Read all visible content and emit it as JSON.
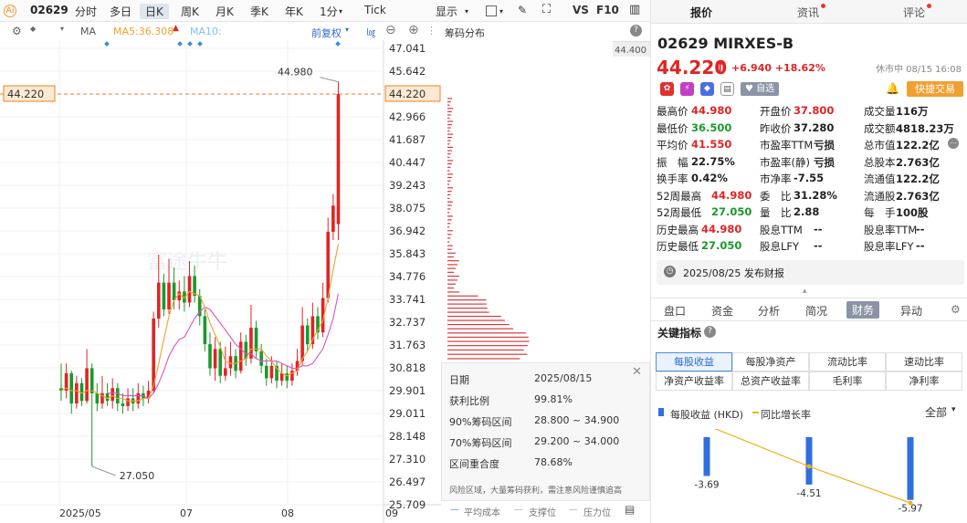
{
  "toolbar": {
    "ai_label": "Ai",
    "code": "02629",
    "periods": [
      "分时",
      "多日",
      "日K",
      "周K",
      "月K",
      "季K",
      "年K",
      "1分"
    ],
    "active_period": "日K",
    "tick": "Tick",
    "display": "显示",
    "vs": "VS",
    "f10": "F10"
  },
  "indicator_bar": {
    "ma": "MA",
    "ma5": "MA5:36.308",
    "ma10": "MA10:",
    "adjust": "前复权",
    "chip_title": "筹码分布"
  },
  "chart_data": {
    "type": "candlestick",
    "y_ticks": [
      "47.041",
      "45.642",
      "44.220",
      "42.966",
      "41.687",
      "40.447",
      "39.243",
      "38.075",
      "36.942",
      "35.843",
      "34.776",
      "33.741",
      "32.737",
      "31.763",
      "30.818",
      "29.901",
      "29.011",
      "28.148",
      "27.310",
      "26.497",
      "25.709"
    ],
    "current_price_label": "44.220",
    "current_price": 44.22,
    "high_annotation": "44.980",
    "low_annotation": "27.050",
    "x_labels": [
      "2025/05",
      "07",
      "08",
      "09"
    ],
    "chip_top_label": "44.400",
    "candles": [
      [
        30.0,
        29.9,
        31.0,
        29.5
      ],
      [
        29.9,
        30.6,
        31.0,
        29.6
      ],
      [
        30.6,
        29.4,
        30.7,
        29.0
      ],
      [
        29.4,
        30.2,
        30.5,
        29.2
      ],
      [
        30.2,
        29.5,
        30.4,
        29.3
      ],
      [
        29.5,
        30.8,
        31.6,
        29.4
      ],
      [
        30.8,
        29.8,
        31.0,
        27.05
      ],
      [
        29.8,
        29.4,
        30.2,
        29.1
      ],
      [
        29.4,
        29.8,
        30.5,
        29.2
      ],
      [
        29.8,
        29.5,
        30.2,
        29.3
      ],
      [
        29.5,
        30.0,
        30.4,
        29.2
      ],
      [
        30.0,
        29.4,
        30.2,
        29.1
      ],
      [
        29.4,
        29.3,
        29.8,
        29.0
      ],
      [
        29.3,
        29.6,
        30.0,
        29.1
      ],
      [
        29.6,
        29.4,
        30.0,
        29.1
      ],
      [
        29.4,
        29.8,
        30.2,
        29.2
      ],
      [
        29.8,
        29.6,
        30.1,
        29.3
      ],
      [
        29.6,
        29.9,
        30.3,
        29.4
      ],
      [
        29.9,
        32.9,
        33.2,
        29.8
      ],
      [
        32.9,
        34.5,
        35.8,
        32.5
      ],
      [
        34.5,
        33.3,
        34.9,
        33.0
      ],
      [
        33.3,
        34.5,
        35.6,
        33.1
      ],
      [
        34.5,
        33.7,
        35.2,
        33.3
      ],
      [
        33.7,
        34.1,
        34.6,
        33.3
      ],
      [
        34.1,
        33.6,
        34.8,
        33.2
      ],
      [
        33.6,
        34.8,
        35.5,
        33.4
      ],
      [
        34.8,
        33.9,
        35.3,
        33.6
      ],
      [
        33.9,
        33.0,
        34.2,
        32.6
      ],
      [
        33.0,
        31.8,
        33.3,
        31.5
      ],
      [
        31.8,
        30.8,
        32.3,
        30.5
      ],
      [
        30.8,
        31.6,
        32.1,
        30.3
      ],
      [
        31.6,
        30.5,
        31.9,
        30.2
      ],
      [
        30.5,
        30.8,
        31.7,
        30.3
      ],
      [
        30.8,
        31.3,
        31.9,
        30.5
      ],
      [
        31.3,
        30.7,
        31.6,
        30.4
      ],
      [
        30.7,
        31.9,
        32.3,
        30.6
      ],
      [
        31.9,
        31.2,
        32.2,
        30.9
      ],
      [
        31.2,
        32.5,
        33.5,
        31.0
      ],
      [
        32.5,
        31.5,
        32.8,
        31.2
      ],
      [
        31.5,
        30.9,
        31.8,
        30.6
      ],
      [
        30.9,
        30.4,
        31.2,
        30.1
      ],
      [
        30.4,
        30.9,
        31.3,
        30.2
      ],
      [
        30.9,
        30.3,
        31.1,
        30.0
      ],
      [
        30.3,
        30.6,
        31.0,
        30.1
      ],
      [
        30.6,
        30.3,
        30.9,
        30.0
      ],
      [
        30.3,
        30.7,
        31.0,
        30.1
      ],
      [
        30.7,
        31.1,
        31.6,
        30.5
      ],
      [
        31.1,
        32.6,
        33.4,
        30.9
      ],
      [
        32.6,
        31.8,
        32.9,
        31.5
      ],
      [
        31.8,
        33.0,
        33.6,
        31.6
      ],
      [
        33.0,
        32.3,
        33.4,
        32.0
      ],
      [
        32.3,
        33.8,
        34.5,
        32.1
      ],
      [
        33.8,
        36.9,
        37.6,
        33.6
      ],
      [
        36.9,
        38.2,
        38.8,
        36.5
      ],
      [
        37.28,
        44.22,
        44.98,
        36.5
      ]
    ],
    "ma5": [
      29.9,
      30.0,
      29.9,
      29.9,
      29.8,
      29.9,
      29.9,
      29.8,
      29.7,
      29.6,
      29.7,
      29.6,
      29.6,
      29.5,
      29.5,
      29.5,
      29.6,
      29.6,
      30.1,
      31.0,
      32.0,
      33.0,
      33.7,
      34.0,
      33.8,
      34.1,
      34.0,
      33.9,
      33.4,
      32.7,
      32.2,
      31.7,
      31.1,
      31.0,
      31.0,
      31.1,
      31.2,
      31.6,
      31.6,
      31.6,
      31.3,
      31.1,
      30.8,
      30.6,
      30.5,
      30.6,
      30.7,
      31.2,
      31.5,
      32.0,
      32.4,
      32.8,
      33.8,
      35.1,
      36.31
    ],
    "ma10": [
      null,
      null,
      null,
      null,
      null,
      null,
      null,
      null,
      null,
      29.8,
      29.8,
      29.8,
      29.7,
      29.7,
      29.7,
      29.7,
      29.7,
      29.6,
      29.8,
      30.2,
      30.7,
      31.3,
      31.7,
      32.0,
      32.1,
      32.5,
      32.9,
      33.2,
      33.4,
      33.3,
      33.0,
      32.7,
      32.4,
      32.1,
      31.8,
      31.6,
      31.4,
      31.4,
      31.2,
      31.1,
      31.1,
      31.1,
      31.1,
      31.0,
      30.9,
      30.8,
      30.8,
      30.9,
      30.9,
      31.0,
      31.3,
      31.6,
      32.2,
      32.9,
      34.0
    ]
  },
  "chip_info": {
    "date_label": "日期",
    "date_value": "2025/08/15",
    "profit_label": "获利比例",
    "profit_value": "99.81%",
    "r90_label": "90%筹码区间",
    "r90_value": "28.800 ~ 34.900",
    "r70_label": "70%筹码区间",
    "r70_value": "29.200 ~ 34.000",
    "overlap_label": "区间重合度",
    "overlap_value": "78.68%",
    "warning": "风险区域，大量筹码获利，需注意风险谨慎追高",
    "legend_avg": "平均成本",
    "legend_support": "支撑位",
    "legend_pressure": "压力位"
  },
  "right_tabs": [
    "报价",
    "资讯",
    "评论"
  ],
  "stock": {
    "code_name": "02629  MIRXES-B",
    "price": "44.220",
    "change": "+6.940  +18.62%",
    "status": "休市中 08/15 16:08",
    "watch": "自选",
    "trade": "快捷交易"
  },
  "quote": [
    [
      [
        "最高价",
        "44.980",
        "red"
      ],
      [
        "开盘价",
        "37.800",
        "red"
      ],
      [
        "成交量",
        "116万",
        ""
      ]
    ],
    [
      [
        "最低价",
        "36.500",
        "green"
      ],
      [
        "昨收价",
        "37.280",
        ""
      ],
      [
        "成交额",
        "4818.23万",
        ""
      ]
    ],
    [
      [
        "平均价",
        "41.550",
        "red"
      ],
      [
        "市盈率TTM",
        "亏损",
        ""
      ],
      [
        "总市值",
        "122.2亿",
        ""
      ]
    ],
    [
      [
        "振　幅",
        "22.75%",
        ""
      ],
      [
        "市盈率(静)",
        "亏损",
        ""
      ],
      [
        "总股本",
        "2.763亿",
        ""
      ]
    ],
    [
      [
        "换手率",
        "0.42%",
        ""
      ],
      [
        "市净率",
        "-7.55",
        ""
      ],
      [
        "流通值",
        "122.2亿",
        ""
      ]
    ],
    [
      [
        "52周最高",
        "44.980",
        "red"
      ],
      [
        "委　比",
        "31.28%",
        ""
      ],
      [
        "流通股",
        "2.763亿",
        ""
      ]
    ],
    [
      [
        "52周最低",
        "27.050",
        "green"
      ],
      [
        "量　比",
        "2.88",
        ""
      ],
      [
        "每　手",
        "100股",
        ""
      ]
    ],
    [
      [
        "历史最高",
        "44.980",
        "red"
      ],
      [
        "股息TTM",
        "--",
        ""
      ],
      [
        "股息率TTM",
        "--",
        ""
      ]
    ],
    [
      [
        "历史最低",
        "27.050",
        "green"
      ],
      [
        "股息LFY",
        "--",
        ""
      ],
      [
        "股息率LFY",
        "--",
        ""
      ]
    ]
  ],
  "notice": "2025/08/25  发布财报",
  "panel_tabs": [
    "盘口",
    "资金",
    "分析",
    "简况",
    "财务",
    "异动"
  ],
  "active_panel_tab": "财务",
  "kpi": {
    "title": "关键指标",
    "cells": [
      "每股收益",
      "每股净资产",
      "流动比率",
      "速动比率",
      "净资产收益率",
      "总资产收益率",
      "毛利率",
      "净利率"
    ],
    "legend_eps": "每股收益 (HKD)",
    "legend_growth": "同比增长率",
    "filter": "全部",
    "eps_values": [
      -3.69,
      -4.51,
      -5.97
    ],
    "eps_labels": [
      "-3.69",
      "-4.51",
      "-5.97"
    ],
    "growth_trend": [
      0.0,
      -0.45,
      -0.85
    ],
    "color_eps": "#2f6fe0",
    "color_growth": "#f0b020"
  },
  "colors": {
    "up": "#e02424",
    "down": "#1a9a2a",
    "ma5": "#f0a030",
    "ma10": "#e050c0",
    "accent": "#f08020"
  }
}
